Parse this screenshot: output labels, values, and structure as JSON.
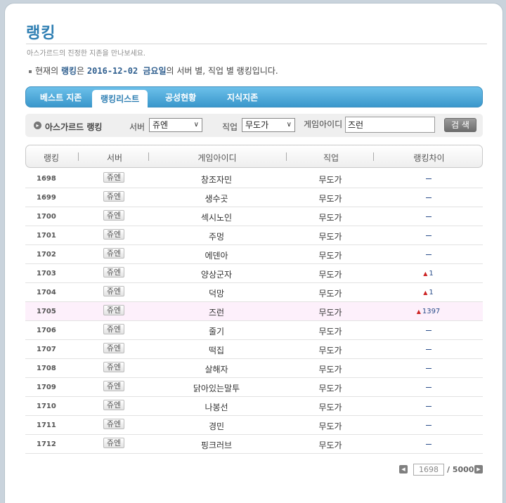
{
  "header": {
    "title": "랭킹",
    "subtitle": "아스가르드의 진정한 지존을 만나보세요.",
    "intro_prefix": "현재의",
    "intro_bold": "랭킹",
    "intro_mid": "은",
    "intro_date": "2016-12-02 금요일",
    "intro_suffix": "의 서버 별, 직업 별 랭킹입니다."
  },
  "tabs": [
    {
      "label": "베스트 지존"
    },
    {
      "label": "랭킹리스트"
    },
    {
      "label": "공성현황"
    },
    {
      "label": "지식지존"
    }
  ],
  "search": {
    "section_label": "아스가르드 랭킹",
    "server_label": "서버",
    "server_value": "쥬엔",
    "job_label": "직업",
    "job_value": "무도가",
    "id_label": "게임아이디",
    "id_value": "즈런",
    "button_label": "검 색"
  },
  "table": {
    "headers": {
      "rank": "랭킹",
      "server": "서버",
      "name": "게임아이디",
      "job": "직업",
      "diff": "랭킹차이"
    },
    "rows": [
      {
        "rank": "1698",
        "server": "쥬엔",
        "name": "창조자민",
        "job": "무도가",
        "diff": ""
      },
      {
        "rank": "1699",
        "server": "쥬엔",
        "name": "생수곳",
        "job": "무도가",
        "diff": ""
      },
      {
        "rank": "1700",
        "server": "쥬엔",
        "name": "섹시노인",
        "job": "무도가",
        "diff": ""
      },
      {
        "rank": "1701",
        "server": "쥬엔",
        "name": "주멍",
        "job": "무도가",
        "diff": ""
      },
      {
        "rank": "1702",
        "server": "쥬엔",
        "name": "에덴아",
        "job": "무도가",
        "diff": ""
      },
      {
        "rank": "1703",
        "server": "쥬엔",
        "name": "양상군자",
        "job": "무도가",
        "diff": "1"
      },
      {
        "rank": "1704",
        "server": "쥬엔",
        "name": "덕망",
        "job": "무도가",
        "diff": "1"
      },
      {
        "rank": "1705",
        "server": "쥬엔",
        "name": "즈런",
        "job": "무도가",
        "diff": "1397",
        "highlight": true
      },
      {
        "rank": "1706",
        "server": "쥬엔",
        "name": "줄기",
        "job": "무도가",
        "diff": ""
      },
      {
        "rank": "1707",
        "server": "쥬엔",
        "name": "떡집",
        "job": "무도가",
        "diff": ""
      },
      {
        "rank": "1708",
        "server": "쥬엔",
        "name": "살해자",
        "job": "무도가",
        "diff": ""
      },
      {
        "rank": "1709",
        "server": "쥬엔",
        "name": "닭아있는말투",
        "job": "무도가",
        "diff": ""
      },
      {
        "rank": "1710",
        "server": "쥬엔",
        "name": "나봉선",
        "job": "무도가",
        "diff": ""
      },
      {
        "rank": "1711",
        "server": "쥬엔",
        "name": "경민",
        "job": "무도가",
        "diff": ""
      },
      {
        "rank": "1712",
        "server": "쥬엔",
        "name": "핑크러브",
        "job": "무도가",
        "diff": ""
      }
    ]
  },
  "pagination": {
    "current": "1698",
    "total": "/ 5000"
  }
}
